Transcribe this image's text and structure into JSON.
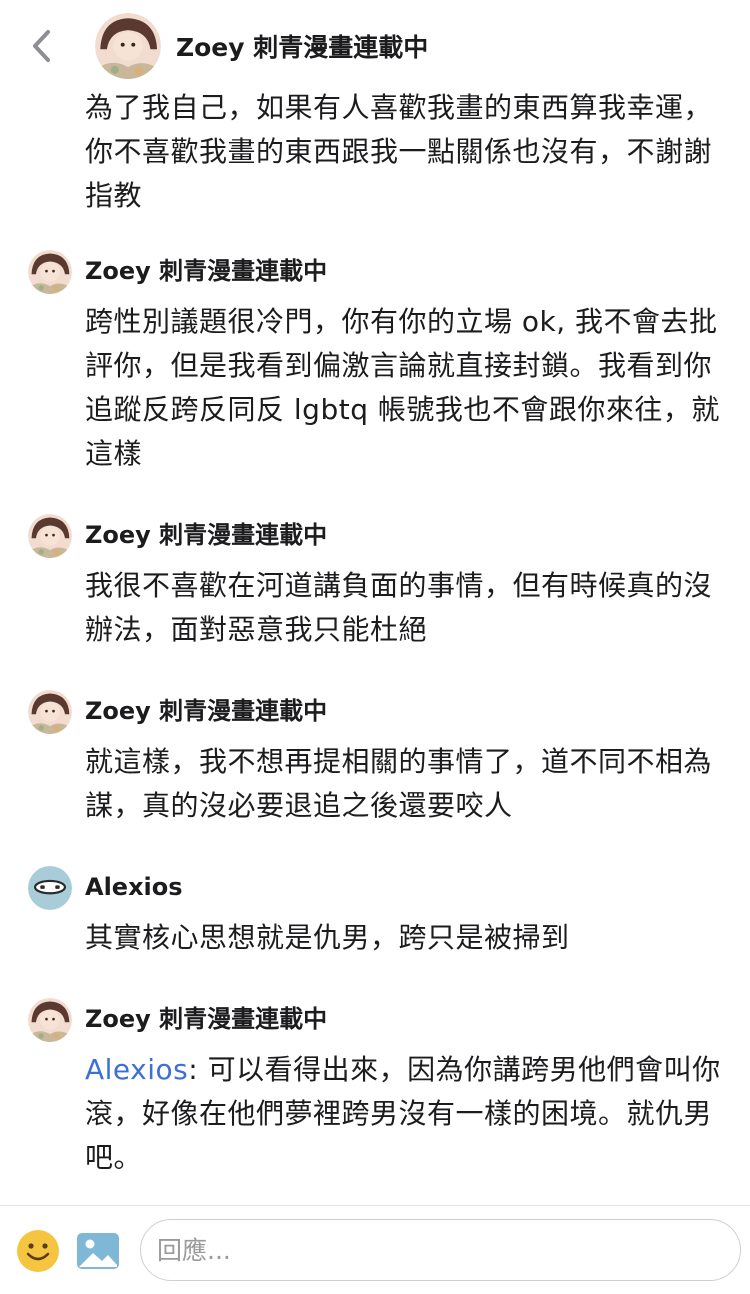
{
  "header": {
    "icon_back": "chevron-left-icon",
    "author": "Zoey 刺青漫畫連載中",
    "body": "為了我自己，如果有人喜歡我畫的東西算我幸運，你不喜歡我畫的東西跟我一點關係也沒有，不謝謝指教"
  },
  "comments": [
    {
      "author": "Zoey 刺青漫畫連載中",
      "body": "跨性別議題很冷門，你有你的立場 ok, 我不會去批評你，但是我看到偏激言論就直接封鎖。我看到你追蹤反跨反同反 lgbtq 帳號我也不會跟你來往，就這樣"
    },
    {
      "author": "Zoey 刺青漫畫連載中",
      "body": "我很不喜歡在河道講負面的事情，但有時候真的沒辦法，面對惡意我只能杜絕"
    },
    {
      "author": "Zoey 刺青漫畫連載中",
      "body": "就這樣，我不想再提相關的事情了，道不同不相為謀，真的沒必要退追之後還要咬人"
    },
    {
      "author": "Alexios",
      "body": "其實核心思想就是仇男，跨只是被掃到"
    },
    {
      "author": "Zoey 刺青漫畫連載中",
      "mention": "Alexios",
      "body": ": 可以看得出來，因為你講跨男他們會叫你滾，好像在他們夢裡跨男沒有一樣的困境。就仇男吧。"
    }
  ],
  "footer": {
    "emoji_icon": "smiley-face-icon",
    "image_icon": "image-icon",
    "reply_placeholder": "回應...",
    "reply_value": ""
  },
  "colors": {
    "mention": "#3d6fd8",
    "text": "#1c1c1e",
    "back_chevron": "#8e8e93",
    "emoji_face": "#f5c542",
    "image_icon": "#7fb7d6"
  }
}
